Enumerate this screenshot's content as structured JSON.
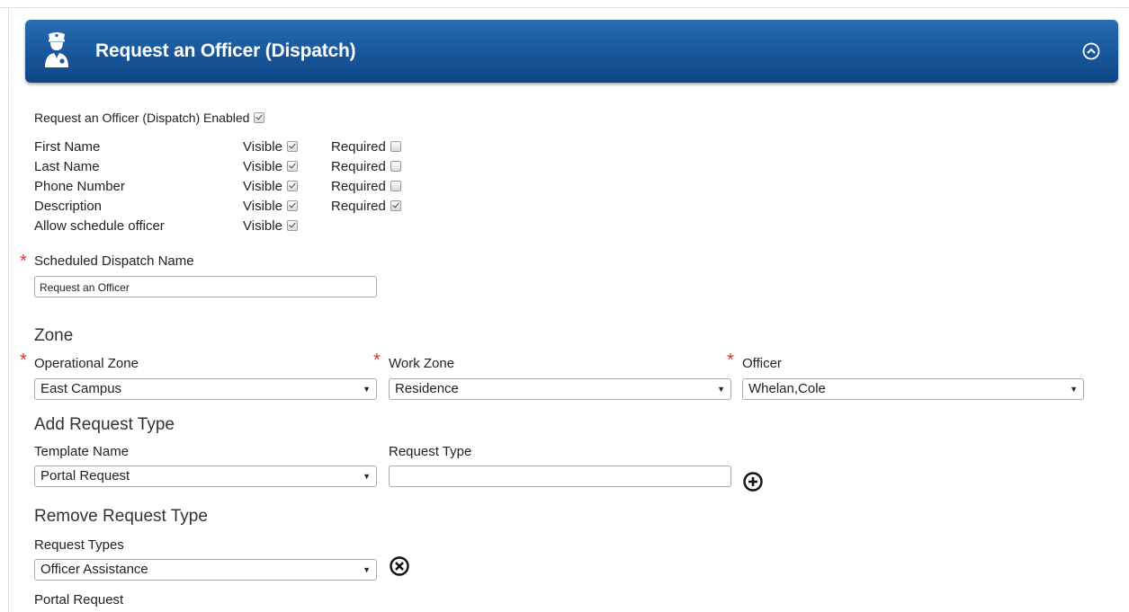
{
  "header": {
    "title": "Request an Officer (Dispatch)",
    "colors": {
      "gradient_top": "#2a6db3",
      "gradient_bottom": "#0f4684",
      "text": "#ffffff"
    }
  },
  "enabled": {
    "label": "Request an Officer (Dispatch) Enabled",
    "checked": true
  },
  "fields": [
    {
      "label": "First Name",
      "visible_label": "Visible",
      "visible": true,
      "required_label": "Required",
      "required": false
    },
    {
      "label": "Last Name",
      "visible_label": "Visible",
      "visible": true,
      "required_label": "Required",
      "required": false
    },
    {
      "label": "Phone Number",
      "visible_label": "Visible",
      "visible": true,
      "required_label": "Required",
      "required": false
    },
    {
      "label": "Description",
      "visible_label": "Visible",
      "visible": true,
      "required_label": "Required",
      "required": true
    },
    {
      "label": "Allow schedule officer",
      "visible_label": "Visible",
      "visible": true
    }
  ],
  "dispatch_name": {
    "label": "Scheduled Dispatch Name",
    "value": "Request an Officer"
  },
  "zone": {
    "heading": "Zone",
    "operational": {
      "label": "Operational Zone",
      "value": "East Campus"
    },
    "work": {
      "label": "Work Zone",
      "value": "Residence"
    },
    "officer": {
      "label": "Officer",
      "value": "Whelan,Cole"
    }
  },
  "add_request": {
    "heading": "Add Request Type",
    "template_label": "Template Name",
    "template_value": "Portal Request",
    "type_label": "Request Type",
    "type_value": ""
  },
  "remove_request": {
    "heading": "Remove Request Type",
    "types_label": "Request Types",
    "types_value": "Officer Assistance",
    "portal_label": "Portal Request"
  },
  "icons": {
    "header": "police-officer-icon",
    "collapse": "chevron-up-circle-icon",
    "add": "plus-circle-icon",
    "remove": "close-circle-icon",
    "required_marker_color": "#e0312c"
  }
}
